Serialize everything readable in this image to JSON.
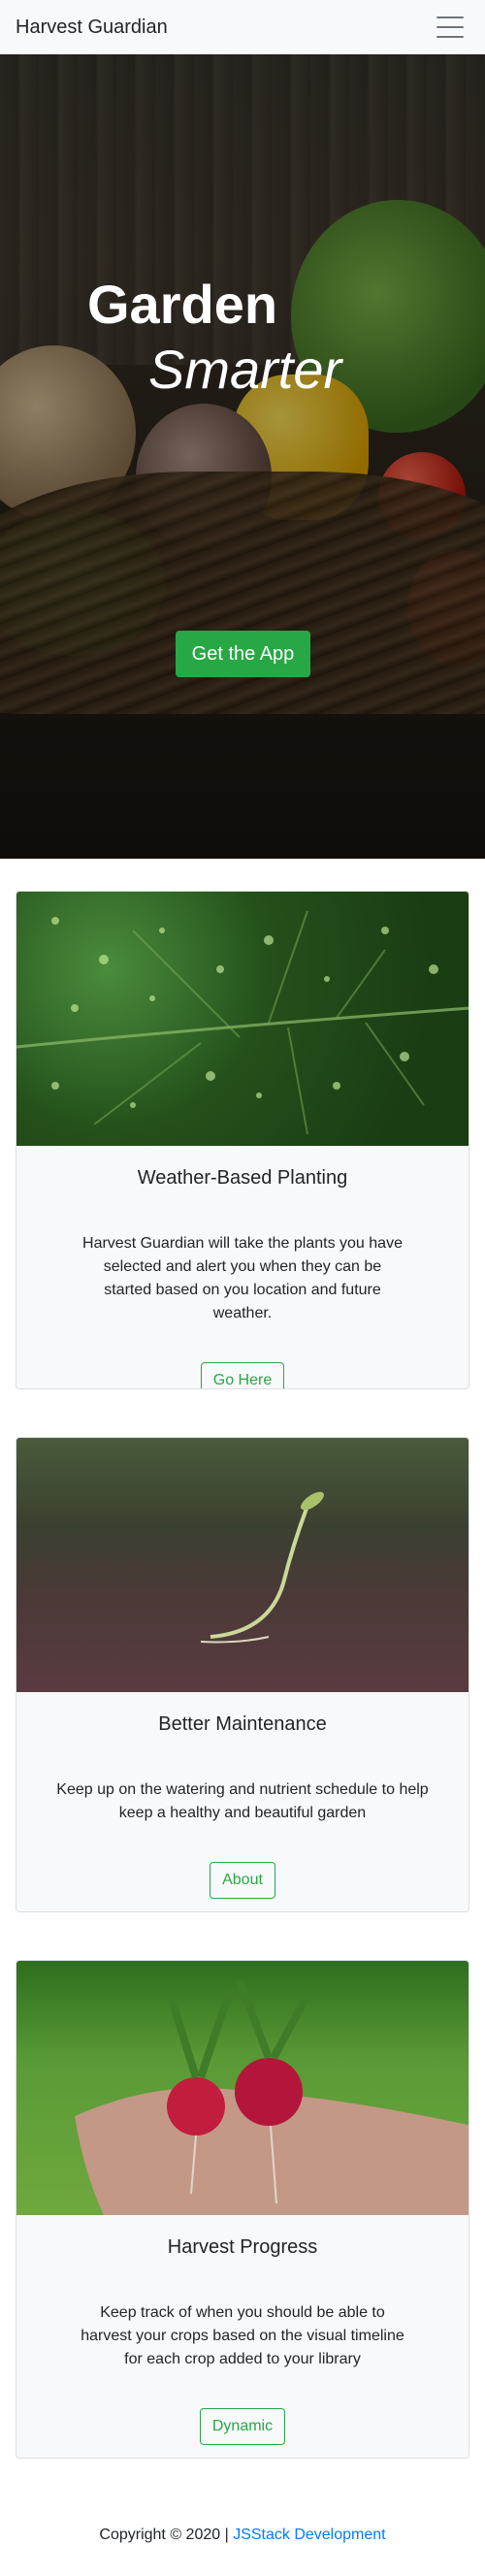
{
  "nav": {
    "brand": "Harvest Guardian",
    "menu_icon": "hamburger-menu-icon"
  },
  "hero": {
    "title": "Garden",
    "subtitle": "Smarter",
    "cta_label": "Get the App"
  },
  "cards": [
    {
      "title": "Weather-Based Planting",
      "text": "Harvest Guardian will take the plants you have selected and alert you when they can be started based on you location and future weather.",
      "button": "Go Here",
      "image": "leaf-with-water-droplets"
    },
    {
      "title": "Better Maintenance",
      "text": "Keep up on the watering and nutrient schedule to help keep a healthy and beautiful garden",
      "button": "About",
      "image": "seedling-sprout"
    },
    {
      "title": "Harvest Progress",
      "text": "Keep track of when you should be able to harvest your crops based on the visual timeline for each crop added to your library",
      "button": "Dynamic",
      "image": "hand-holding-radishes"
    }
  ],
  "footer": {
    "copyright": "Copyright © 2020 | ",
    "link": "JSStack Development"
  },
  "colors": {
    "accent": "#28a745",
    "link": "#007bff",
    "navbar_bg": "#f8f9fa"
  }
}
